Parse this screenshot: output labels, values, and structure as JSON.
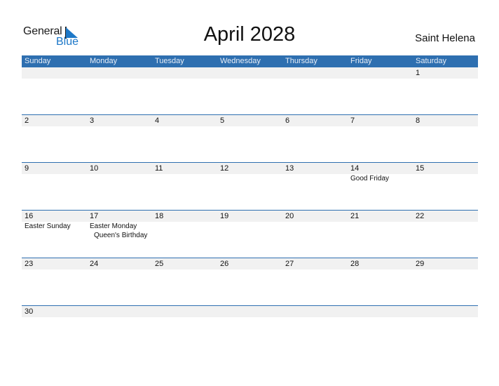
{
  "logo": {
    "general": "General",
    "blue": "Blue"
  },
  "header": {
    "title": "April 2028",
    "country": "Saint Helena"
  },
  "weekdays": [
    "Sunday",
    "Monday",
    "Tuesday",
    "Wednesday",
    "Thursday",
    "Friday",
    "Saturday"
  ],
  "weeks": [
    [
      {
        "d": ""
      },
      {
        "d": ""
      },
      {
        "d": ""
      },
      {
        "d": ""
      },
      {
        "d": ""
      },
      {
        "d": ""
      },
      {
        "d": "1"
      }
    ],
    [
      {
        "d": "2"
      },
      {
        "d": "3"
      },
      {
        "d": "4"
      },
      {
        "d": "5"
      },
      {
        "d": "6"
      },
      {
        "d": "7"
      },
      {
        "d": "8"
      }
    ],
    [
      {
        "d": "9"
      },
      {
        "d": "10"
      },
      {
        "d": "11"
      },
      {
        "d": "12"
      },
      {
        "d": "13"
      },
      {
        "d": "14",
        "events": [
          "Good Friday"
        ]
      },
      {
        "d": "15"
      }
    ],
    [
      {
        "d": "16",
        "events": [
          "Easter Sunday"
        ]
      },
      {
        "d": "17",
        "events": [
          "Easter Monday",
          "Queen's Birthday"
        ]
      },
      {
        "d": "18"
      },
      {
        "d": "19"
      },
      {
        "d": "20"
      },
      {
        "d": "21"
      },
      {
        "d": "22"
      }
    ],
    [
      {
        "d": "23"
      },
      {
        "d": "24"
      },
      {
        "d": "25"
      },
      {
        "d": "26"
      },
      {
        "d": "27"
      },
      {
        "d": "28"
      },
      {
        "d": "29"
      }
    ],
    [
      {
        "d": "30"
      },
      {
        "d": ""
      },
      {
        "d": ""
      },
      {
        "d": ""
      },
      {
        "d": ""
      },
      {
        "d": ""
      },
      {
        "d": ""
      }
    ]
  ],
  "colors": {
    "header": "#2e6fb0",
    "strip": "#f1f1f1",
    "brand_blue": "#1d78c8"
  }
}
